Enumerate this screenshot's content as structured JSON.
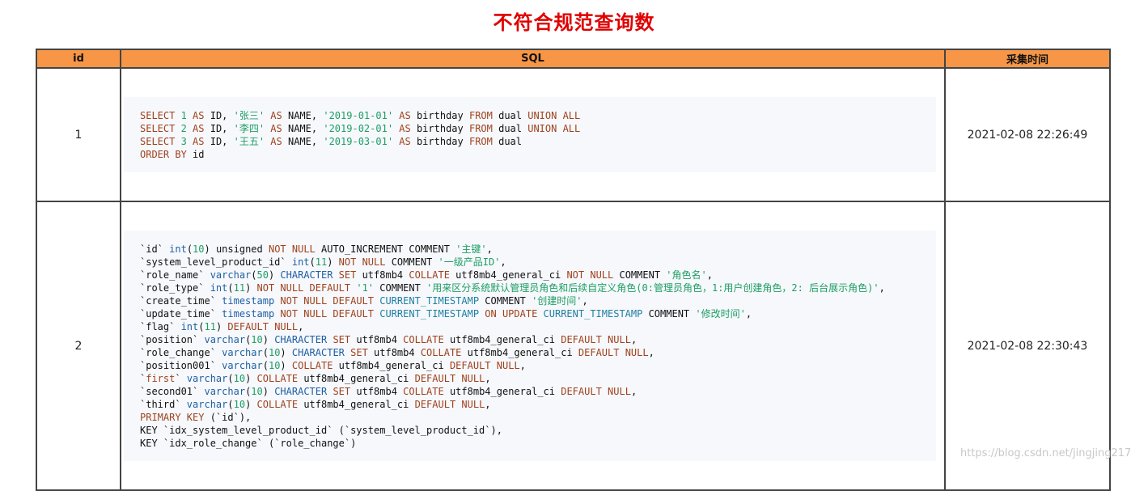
{
  "page": {
    "title": "不符合规范查询数",
    "watermark": "https://blog.csdn.net/jingjing217"
  },
  "table": {
    "headers": {
      "id": "id",
      "sql": "SQL",
      "time": "采集时间"
    },
    "header_color": "#f79646",
    "rows": [
      {
        "id": "1",
        "time": "2021-02-08 22:26:49",
        "lines": [
          [
            [
              "kw",
              "SELECT "
            ],
            [
              "num",
              "1"
            ],
            [
              "kw",
              " AS "
            ],
            [
              "plain",
              "ID, "
            ],
            [
              "str",
              "'张三'"
            ],
            [
              "kw",
              " AS "
            ],
            [
              "plain",
              "NAME, "
            ],
            [
              "str",
              "'2019-01-01'"
            ],
            [
              "kw",
              " AS "
            ],
            [
              "plain",
              "birthday "
            ],
            [
              "kw",
              "FROM "
            ],
            [
              "plain",
              "dual "
            ],
            [
              "kw",
              "UNION ALL"
            ]
          ],
          [
            [
              "kw",
              "SELECT "
            ],
            [
              "num",
              "2"
            ],
            [
              "kw",
              " AS "
            ],
            [
              "plain",
              "ID, "
            ],
            [
              "str",
              "'李四'"
            ],
            [
              "kw",
              " AS "
            ],
            [
              "plain",
              "NAME, "
            ],
            [
              "str",
              "'2019-02-01'"
            ],
            [
              "kw",
              " AS "
            ],
            [
              "plain",
              "birthday "
            ],
            [
              "kw",
              "FROM "
            ],
            [
              "plain",
              "dual "
            ],
            [
              "kw",
              "UNION ALL"
            ]
          ],
          [
            [
              "kw",
              "SELECT "
            ],
            [
              "num",
              "3"
            ],
            [
              "kw",
              " AS "
            ],
            [
              "plain",
              "ID, "
            ],
            [
              "str",
              "'王五'"
            ],
            [
              "kw",
              " AS "
            ],
            [
              "plain",
              "NAME, "
            ],
            [
              "str",
              "'2019-03-01'"
            ],
            [
              "kw",
              " AS "
            ],
            [
              "plain",
              "birthday "
            ],
            [
              "kw",
              "FROM "
            ],
            [
              "plain",
              "dual"
            ]
          ],
          [
            [
              "kw",
              "ORDER BY "
            ],
            [
              "plain",
              "id"
            ]
          ]
        ]
      },
      {
        "id": "2",
        "time": "2021-02-08 22:30:43",
        "lines": [
          [
            [
              "plain",
              "`id` "
            ],
            [
              "type",
              "int"
            ],
            [
              "plain",
              "("
            ],
            [
              "num",
              "10"
            ],
            [
              "plain",
              ") unsigned "
            ],
            [
              "kw",
              "NOT NULL "
            ],
            [
              "plain",
              "AUTO_INCREMENT COMMENT "
            ],
            [
              "str",
              "'主键'"
            ],
            [
              "plain",
              ","
            ]
          ],
          [
            [
              "plain",
              "`system_level_product_id` "
            ],
            [
              "type",
              "int"
            ],
            [
              "plain",
              "("
            ],
            [
              "num",
              "11"
            ],
            [
              "plain",
              ") "
            ],
            [
              "kw",
              "NOT NULL "
            ],
            [
              "plain",
              "COMMENT "
            ],
            [
              "str",
              "'一级产品ID'"
            ],
            [
              "plain",
              ","
            ]
          ],
          [
            [
              "plain",
              "`role_name` "
            ],
            [
              "type",
              "varchar"
            ],
            [
              "plain",
              "("
            ],
            [
              "num",
              "50"
            ],
            [
              "plain",
              ") "
            ],
            [
              "type",
              "CHARACTER "
            ],
            [
              "kw",
              "SET "
            ],
            [
              "plain",
              "utf8mb4 "
            ],
            [
              "kw",
              "COLLATE "
            ],
            [
              "plain",
              "utf8mb4_general_ci "
            ],
            [
              "kw",
              "NOT NULL "
            ],
            [
              "plain",
              "COMMENT "
            ],
            [
              "str",
              "'角色名'"
            ],
            [
              "plain",
              ","
            ]
          ],
          [
            [
              "plain",
              "`role_type` "
            ],
            [
              "type",
              "int"
            ],
            [
              "plain",
              "("
            ],
            [
              "num",
              "11"
            ],
            [
              "plain",
              ") "
            ],
            [
              "kw",
              "NOT NULL DEFAULT "
            ],
            [
              "str",
              "'1'"
            ],
            [
              "plain",
              " COMMENT "
            ],
            [
              "str",
              "'用来区分系统默认管理员角色和后续自定义角色(0:管理员角色，1:用户创建角色，2: 后台展示角色)'"
            ],
            [
              "plain",
              ","
            ]
          ],
          [
            [
              "plain",
              "`create_time` "
            ],
            [
              "type",
              "timestamp "
            ],
            [
              "kw",
              "NOT NULL DEFAULT "
            ],
            [
              "bi",
              "CURRENT_TIMESTAMP "
            ],
            [
              "plain",
              "COMMENT "
            ],
            [
              "str",
              "'创建时间'"
            ],
            [
              "plain",
              ","
            ]
          ],
          [
            [
              "plain",
              "`update_time` "
            ],
            [
              "type",
              "timestamp "
            ],
            [
              "kw",
              "NOT NULL DEFAULT "
            ],
            [
              "bi",
              "CURRENT_TIMESTAMP "
            ],
            [
              "kw",
              "ON UPDATE "
            ],
            [
              "bi",
              "CURRENT_TIMESTAMP "
            ],
            [
              "plain",
              "COMMENT "
            ],
            [
              "str",
              "'修改时间'"
            ],
            [
              "plain",
              ","
            ]
          ],
          [
            [
              "plain",
              "`flag` "
            ],
            [
              "type",
              "int"
            ],
            [
              "plain",
              "("
            ],
            [
              "num",
              "11"
            ],
            [
              "plain",
              ") "
            ],
            [
              "kw",
              "DEFAULT NULL"
            ],
            [
              "plain",
              ","
            ]
          ],
          [
            [
              "plain",
              "`position` "
            ],
            [
              "type",
              "varchar"
            ],
            [
              "plain",
              "("
            ],
            [
              "num",
              "10"
            ],
            [
              "plain",
              ") "
            ],
            [
              "type",
              "CHARACTER "
            ],
            [
              "kw",
              "SET "
            ],
            [
              "plain",
              "utf8mb4 "
            ],
            [
              "kw",
              "COLLATE "
            ],
            [
              "plain",
              "utf8mb4_general_ci "
            ],
            [
              "kw",
              "DEFAULT NULL"
            ],
            [
              "plain",
              ","
            ]
          ],
          [
            [
              "plain",
              "`role_change` "
            ],
            [
              "type",
              "varchar"
            ],
            [
              "plain",
              "("
            ],
            [
              "num",
              "10"
            ],
            [
              "plain",
              ") "
            ],
            [
              "type",
              "CHARACTER "
            ],
            [
              "kw",
              "SET "
            ],
            [
              "plain",
              "utf8mb4 "
            ],
            [
              "kw",
              "COLLATE "
            ],
            [
              "plain",
              "utf8mb4_general_ci "
            ],
            [
              "kw",
              "DEFAULT NULL"
            ],
            [
              "plain",
              ","
            ]
          ],
          [
            [
              "plain",
              "`position001` "
            ],
            [
              "type",
              "varchar"
            ],
            [
              "plain",
              "("
            ],
            [
              "num",
              "10"
            ],
            [
              "plain",
              ") "
            ],
            [
              "kw",
              "COLLATE "
            ],
            [
              "plain",
              "utf8mb4_general_ci "
            ],
            [
              "kw",
              "DEFAULT NULL"
            ],
            [
              "plain",
              ","
            ]
          ],
          [
            [
              "plain",
              "`"
            ],
            [
              "kw",
              "first"
            ],
            [
              "plain",
              "` "
            ],
            [
              "type",
              "varchar"
            ],
            [
              "plain",
              "("
            ],
            [
              "num",
              "10"
            ],
            [
              "plain",
              ") "
            ],
            [
              "kw",
              "COLLATE "
            ],
            [
              "plain",
              "utf8mb4_general_ci "
            ],
            [
              "kw",
              "DEFAULT NULL"
            ],
            [
              "plain",
              ","
            ]
          ],
          [
            [
              "plain",
              "`second01` "
            ],
            [
              "type",
              "varchar"
            ],
            [
              "plain",
              "("
            ],
            [
              "num",
              "10"
            ],
            [
              "plain",
              ") "
            ],
            [
              "type",
              "CHARACTER "
            ],
            [
              "kw",
              "SET "
            ],
            [
              "plain",
              "utf8mb4 "
            ],
            [
              "kw",
              "COLLATE "
            ],
            [
              "plain",
              "utf8mb4_general_ci "
            ],
            [
              "kw",
              "DEFAULT NULL"
            ],
            [
              "plain",
              ","
            ]
          ],
          [
            [
              "plain",
              "`third` "
            ],
            [
              "type",
              "varchar"
            ],
            [
              "plain",
              "("
            ],
            [
              "num",
              "10"
            ],
            [
              "plain",
              ") "
            ],
            [
              "kw",
              "COLLATE "
            ],
            [
              "plain",
              "utf8mb4_general_ci "
            ],
            [
              "kw",
              "DEFAULT NULL"
            ],
            [
              "plain",
              ","
            ]
          ],
          [
            [
              "kw",
              "PRIMARY KEY "
            ],
            [
              "plain",
              "(`id`),"
            ]
          ],
          [
            [
              "plain",
              "KEY `idx_system_level_product_id` (`system_level_product_id`),"
            ]
          ],
          [
            [
              "plain",
              "KEY `idx_role_change` (`role_change`)"
            ]
          ]
        ]
      }
    ]
  },
  "colors": {
    "title": "#e00000",
    "header_bg": "#f79646",
    "keyword": "#a0421c",
    "string": "#1e9e64",
    "type": "#1f5fa3",
    "code_bg": "#f6f8fc"
  }
}
